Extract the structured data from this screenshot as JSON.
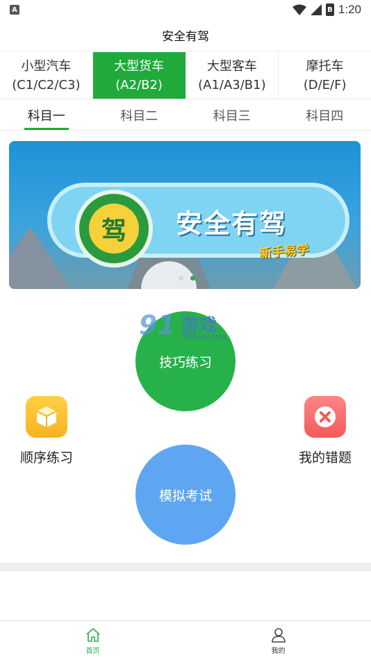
{
  "status_bar": {
    "notification_badge": "A",
    "battery_label": "B",
    "time": "1:20"
  },
  "header": {
    "title": "安全有驾"
  },
  "vehicle_tabs": [
    {
      "name": "小型汽车",
      "codes": "(C1/C2/C3)",
      "active": false
    },
    {
      "name": "大型货车",
      "codes": "(A2/B2)",
      "active": true
    },
    {
      "name": "大型客车",
      "codes": "(A1/A3/B1)",
      "active": false
    },
    {
      "name": "摩托车",
      "codes": "(D/E/F)",
      "active": false
    }
  ],
  "subject_tabs": [
    {
      "label": "科目一",
      "active": true
    },
    {
      "label": "科目二",
      "active": false
    },
    {
      "label": "科目三",
      "active": false
    },
    {
      "label": "科目四",
      "active": false
    }
  ],
  "banner": {
    "seal_char": "驾",
    "title": "安全有驾",
    "subtitle": "新手易学",
    "slide_count": 2,
    "active_slide": 2
  },
  "watermark": {
    "number": "91",
    "text": "游戏",
    "url": "91danji.com"
  },
  "actions": {
    "skill_practice": "技巧练习",
    "mock_exam": "模拟考试",
    "sequential_practice": "顺序练习",
    "my_mistakes": "我的错题"
  },
  "bottom_nav": [
    {
      "label": "首页",
      "icon": "home-icon",
      "active": true
    },
    {
      "label": "我的",
      "icon": "user-icon",
      "active": false
    }
  ],
  "colors": {
    "accent": "#1faa3a",
    "circle_green": "#27b14a",
    "circle_blue": "#5ea6f2",
    "icon_yellow": "#f6b320",
    "icon_red": "#f25a5a"
  }
}
